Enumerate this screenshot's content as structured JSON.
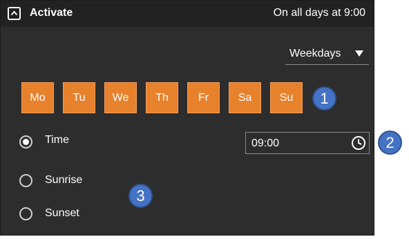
{
  "header": {
    "title": "Activate",
    "summary": "On all days at 9:00",
    "collapse_icon": "chevron-up-icon"
  },
  "schedule": {
    "mode_label": "Weekdays",
    "dropdown_icon": "caret-down-icon",
    "days": [
      "Mo",
      "Tu",
      "We",
      "Th",
      "Fr",
      "Sa",
      "Su"
    ],
    "day_selected_color": "#e8812b"
  },
  "trigger": {
    "options": [
      "Time",
      "Sunrise",
      "Sunset"
    ],
    "selected": "Time",
    "time_value": "09:00",
    "time_icon": "clock-icon"
  },
  "callouts": [
    "1",
    "2",
    "3"
  ]
}
